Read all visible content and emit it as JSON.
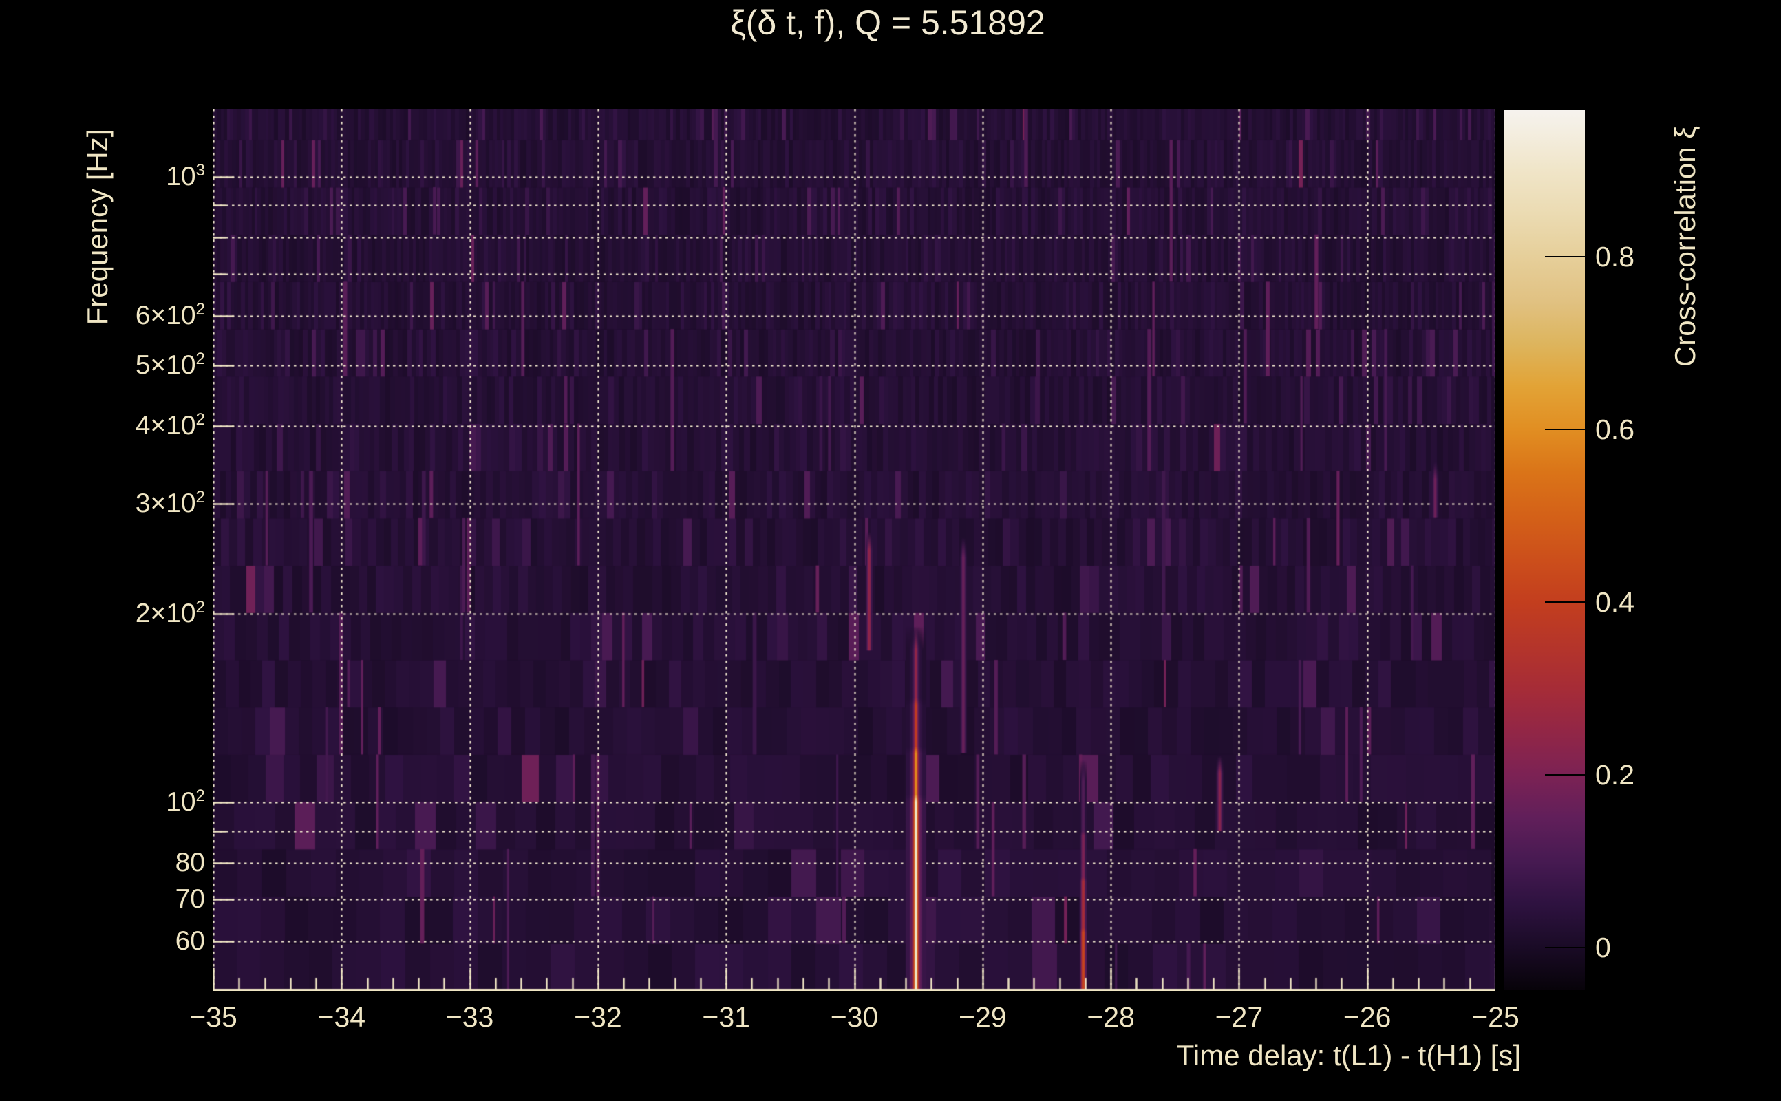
{
  "page": {
    "background": "#000000"
  },
  "chart_data": {
    "type": "heatmap",
    "title": "ξ(δ t, f), Q = 5.51892",
    "q_value": 5.51892,
    "xlabel": "Time delay: t(L1) - t(H1) [s]",
    "ylabel": "Frequency [Hz]",
    "zlabel": "Cross-correlation ξ",
    "grid": true,
    "x_axis": {
      "min": -35,
      "max": -25,
      "major_ticks": [
        -35,
        -34,
        -33,
        -32,
        -31,
        -30,
        -29,
        -28,
        -27,
        -26,
        -25
      ],
      "major_tick_labels": [
        "−35",
        "−34",
        "−33",
        "−32",
        "−31",
        "−30",
        "−29",
        "−28",
        "−27",
        "−26",
        "−25"
      ],
      "minor_tick_step": 0.2
    },
    "y_axis": {
      "scale": "log",
      "min": 50,
      "max": 1281,
      "gridline_freqs": [
        60,
        70,
        80,
        90,
        100,
        200,
        300,
        400,
        500,
        600,
        700,
        800,
        900,
        1000
      ],
      "unlabeled_freqs": [
        90,
        700,
        800,
        900
      ],
      "tick_labels": [
        {
          "f": 1000,
          "base": "10",
          "sup": "3"
        },
        {
          "f": 600,
          "base": "6×10",
          "sup": "2"
        },
        {
          "f": 500,
          "base": "5×10",
          "sup": "2"
        },
        {
          "f": 400,
          "base": "4×10",
          "sup": "2"
        },
        {
          "f": 300,
          "base": "3×10",
          "sup": "2"
        },
        {
          "f": 200,
          "base": "2×10",
          "sup": "2"
        },
        {
          "f": 100,
          "base": "10",
          "sup": "2"
        },
        {
          "f": 80,
          "base": "80",
          "sup": ""
        },
        {
          "f": 70,
          "base": "70",
          "sup": ""
        },
        {
          "f": 60,
          "base": "60",
          "sup": ""
        }
      ]
    },
    "colorbar": {
      "min": -0.049,
      "max": 0.97,
      "ticks": [
        {
          "v": 0,
          "label": "0"
        },
        {
          "v": 0.2,
          "label": "0.2"
        },
        {
          "v": 0.4,
          "label": "0.4"
        },
        {
          "v": 0.6,
          "label": "0.6"
        },
        {
          "v": 0.8,
          "label": "0.8"
        }
      ],
      "colormap": [
        [
          -0.05,
          "#070309"
        ],
        [
          0.0,
          "#1a0b26"
        ],
        [
          0.05,
          "#2e1240"
        ],
        [
          0.1,
          "#471a52"
        ],
        [
          0.15,
          "#611f5a"
        ],
        [
          0.2,
          "#7c2254"
        ],
        [
          0.25,
          "#922646"
        ],
        [
          0.3,
          "#a62c37"
        ],
        [
          0.35,
          "#b5352a"
        ],
        [
          0.4,
          "#c33e1e"
        ],
        [
          0.45,
          "#cc4f1b"
        ],
        [
          0.5,
          "#d46118"
        ],
        [
          0.55,
          "#da7418"
        ],
        [
          0.6,
          "#e18e22"
        ],
        [
          0.65,
          "#e2a336"
        ],
        [
          0.7,
          "#ddb55e"
        ],
        [
          0.75,
          "#e1c283"
        ],
        [
          0.8,
          "#e6cf9a"
        ],
        [
          0.85,
          "#ebdbb2"
        ],
        [
          0.9,
          "#f0e5c8"
        ],
        [
          0.97,
          "#f6f3ee"
        ]
      ]
    },
    "background_noise": {
      "value_range": [
        0.0,
        0.16
      ],
      "seed": 20240905
    },
    "features": [
      {
        "t": -29.52,
        "glow": true,
        "segments": [
          {
            "f0": 50,
            "f1": 103,
            "v": 0.88
          },
          {
            "f0": 103,
            "f1": 123,
            "v": 0.58
          },
          {
            "f0": 123,
            "f1": 147,
            "v": 0.38
          },
          {
            "f0": 147,
            "f1": 180,
            "v": 0.24
          }
        ]
      },
      {
        "t": -28.215,
        "glow": false,
        "segments": [
          {
            "f0": 50,
            "f1": 63,
            "v": 0.42
          },
          {
            "f0": 63,
            "f1": 76,
            "v": 0.3
          },
          {
            "f0": 76,
            "f1": 90,
            "v": 0.2
          },
          {
            "f0": 90,
            "f1": 110,
            "v": 0.12
          }
        ]
      },
      {
        "t": -29.885,
        "glow": false,
        "segments": [
          {
            "f0": 175,
            "f1": 255,
            "v": 0.24
          }
        ]
      },
      {
        "t": -29.15,
        "glow": false,
        "segments": [
          {
            "f0": 120,
            "f1": 250,
            "v": 0.16
          }
        ]
      },
      {
        "t": -27.15,
        "glow": false,
        "segments": [
          {
            "f0": 90,
            "f1": 112,
            "v": 0.22
          }
        ]
      },
      {
        "t": -25.47,
        "glow": false,
        "segments": [
          {
            "f0": 285,
            "f1": 330,
            "v": 0.17
          }
        ]
      }
    ],
    "text_color": "#f0e6c4",
    "gridline_color": "#f3ead0"
  }
}
